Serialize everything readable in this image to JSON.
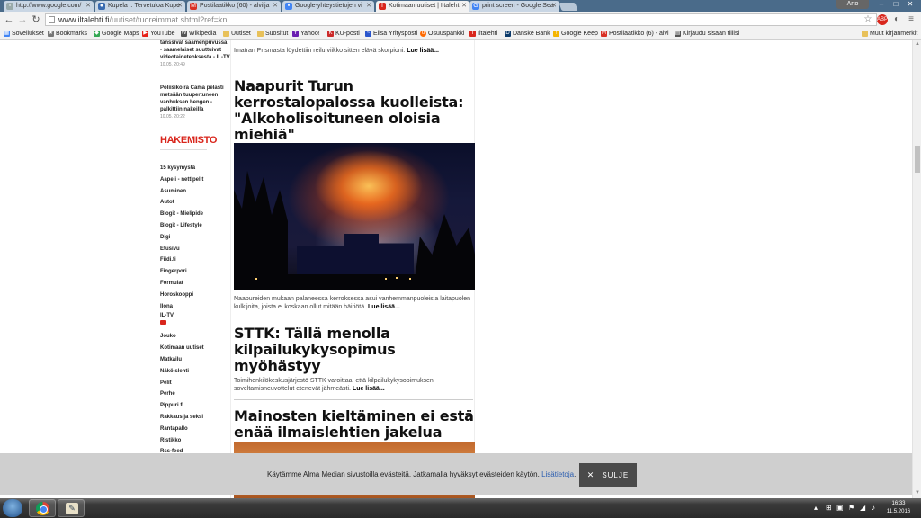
{
  "browser": {
    "tabs": [
      {
        "label": "http://www.google.com/",
        "icon": "page-icon",
        "active": false
      },
      {
        "label": "Kupela :: Tervetuloa Kupe",
        "icon": "kupela-icon",
        "active": false
      },
      {
        "label": "Postilaatikko (60) - alvilja",
        "icon": "gmail-icon",
        "active": false
      },
      {
        "label": "Google-yhteystietojen vi",
        "icon": "google-contacts-icon",
        "active": false
      },
      {
        "label": "Kotimaan uutiset | Iltalehti",
        "icon": "iltalehti-icon",
        "active": true
      },
      {
        "label": "print screen - Google Sea",
        "icon": "google-icon",
        "active": false
      }
    ],
    "user_name": "Arto",
    "url_host": "www.iltalehti.fi",
    "url_path": "/uutiset/tuoreimmat.shtml?ref=kn",
    "bookmarks": [
      {
        "label": "Sovellukset",
        "icon": "apps-icon",
        "color": "#4285f4"
      },
      {
        "label": "Bookmarks",
        "icon": "star-icon",
        "color": "#777777"
      },
      {
        "label": "Google Maps",
        "icon": "maps-icon",
        "color": "#34a853"
      },
      {
        "label": "YouTube",
        "icon": "youtube-icon",
        "color": "#e62117"
      },
      {
        "label": "Wikipedia",
        "icon": "wikipedia-icon",
        "color": "#555555"
      },
      {
        "label": "Uutiset",
        "icon": "folder-icon",
        "color": "#e8c15a"
      },
      {
        "label": "Suositut",
        "icon": "folder-icon",
        "color": "#e8c15a"
      },
      {
        "label": "Yahoo!",
        "icon": "yahoo-icon",
        "color": "#6b1fb1"
      },
      {
        "label": "KU-posti",
        "icon": "ku-icon",
        "color": "#cc2a2a"
      },
      {
        "label": "Elisa Yritysposti",
        "icon": "elisa-icon",
        "color": "#2a55cc"
      },
      {
        "label": "Osuuspankki",
        "icon": "op-icon",
        "color": "#ff6a00"
      },
      {
        "label": "Iltalehti",
        "icon": "iltalehti-icon",
        "color": "#d9261c"
      },
      {
        "label": "Danske Bank",
        "icon": "danske-icon",
        "color": "#0b3a6b"
      },
      {
        "label": "Google Keep",
        "icon": "keep-icon",
        "color": "#f4b400"
      },
      {
        "label": "Postilaatikko (6) - alvi",
        "icon": "gmail-icon",
        "color": "#d93025"
      },
      {
        "label": "Kirjaudu sisään tiliisi",
        "icon": "login-icon",
        "color": "#555555"
      }
    ],
    "other_bookmarks": "Muut kirjanmerkit"
  },
  "sidebar": {
    "news": [
      {
        "text": "tanssivat saamenpuvussa - saamelaiset suuttuivat videotaideteoksesta - IL-TV",
        "time": "10.05. 20:49"
      },
      {
        "text": "Poliisikoira Cama pelasti metsään tuupertuneen vanhuksen hengen - palkittiin nakeilla",
        "time": "10.05. 20:22"
      }
    ],
    "directory_title": "HAKEMISTO",
    "directory": [
      "15 kysymystä",
      "Aapeli - nettipelit",
      "Asuminen",
      "Autot",
      "Blogit - Mielipide",
      "Blogit - Lifestyle",
      "Digi",
      "Etusivu",
      "Fiidi.fi",
      "Fingerpori",
      "Formulat",
      "Horoskooppi",
      "Ilona",
      "IL-TV",
      "Jouko",
      "Kotimaan uutiset",
      "Matkailu",
      "Näköislehti",
      "Pelit",
      "Perhe",
      "Pippuri.fi",
      "Rakkaus ja seksi",
      "Rantapallo",
      "Ristikko",
      "Rss-feed"
    ]
  },
  "articles": {
    "prev_lead": "Imatran Prismasta löydettiin reilu viikko sitten elävä skorpioni.",
    "read_more": "Lue lisää...",
    "a1_title": "Naapurit Turun kerrostalopalossa kuolleista: \"Alkoholisoituneen oloisia miehiä\"",
    "a1_lead": "Naapureiden mukaan palaneessa kerroksessa asui vanhemmanpuoleisia laitapuolen kulkijoita, joista ei koskaan ollut mitään häiriötä.",
    "a2_title": "STTK: Tällä menolla kilpailukykysopimus myöhästyy",
    "a2_lead": "Toimihenkilökeskusjärjestö STTK varoittaa, että kilpailukykysopimuksen soveltamisneuvottelut etenevät jähmeästi.",
    "a3_title": "Mainosten kieltäminen ei estä enää ilmaislehtien jakelua"
  },
  "cookie": {
    "text_before": "Käytämme Alma Median sivustoilla evästeitä. Jatkamalla ",
    "accept_link": "hyväksyt evästeiden käytön",
    "text_after": ". ",
    "info_link": "Lisätietoja",
    "info_after": ".",
    "close_label": "SULJE"
  },
  "taskbar": {
    "time": "16:33",
    "date": "11.5.2016"
  }
}
